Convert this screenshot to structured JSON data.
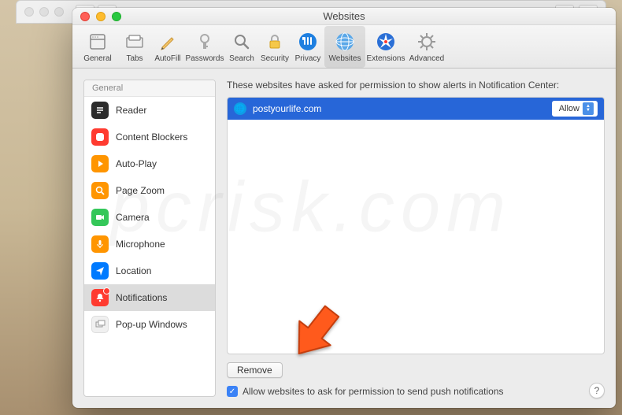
{
  "window": {
    "title": "Websites"
  },
  "toolbar": {
    "items": [
      {
        "label": "General",
        "icon": "⚙"
      },
      {
        "label": "Tabs",
        "icon": "▭"
      },
      {
        "label": "AutoFill",
        "icon": "✎"
      },
      {
        "label": "Passwords",
        "icon": "🔑"
      },
      {
        "label": "Search",
        "icon": "🔍"
      },
      {
        "label": "Security",
        "icon": "🔒"
      },
      {
        "label": "Privacy",
        "icon": "✋"
      },
      {
        "label": "Websites",
        "icon": "🌐"
      },
      {
        "label": "Extensions",
        "icon": "🧭"
      },
      {
        "label": "Advanced",
        "icon": "⚙"
      }
    ]
  },
  "sidebar": {
    "header": "General",
    "items": [
      {
        "label": "Reader",
        "color": "#2c2c2c"
      },
      {
        "label": "Content Blockers",
        "color": "#ff3b30"
      },
      {
        "label": "Auto-Play",
        "color": "#ff9500"
      },
      {
        "label": "Page Zoom",
        "color": "#ff9500"
      },
      {
        "label": "Camera",
        "color": "#34c759"
      },
      {
        "label": "Microphone",
        "color": "#ff9500"
      },
      {
        "label": "Location",
        "color": "#007aff"
      },
      {
        "label": "Notifications",
        "color": "#ff3b30"
      },
      {
        "label": "Pop-up Windows",
        "color": "#e8e8e8"
      }
    ]
  },
  "main": {
    "description": "These websites have asked for permission to show alerts in Notification Center:",
    "sites": [
      {
        "name": "postyourlife.com",
        "permission": "Allow"
      }
    ],
    "remove_label": "Remove",
    "checkbox_label": "Allow websites to ask for permission to send push notifications"
  },
  "help_tooltip": "?"
}
